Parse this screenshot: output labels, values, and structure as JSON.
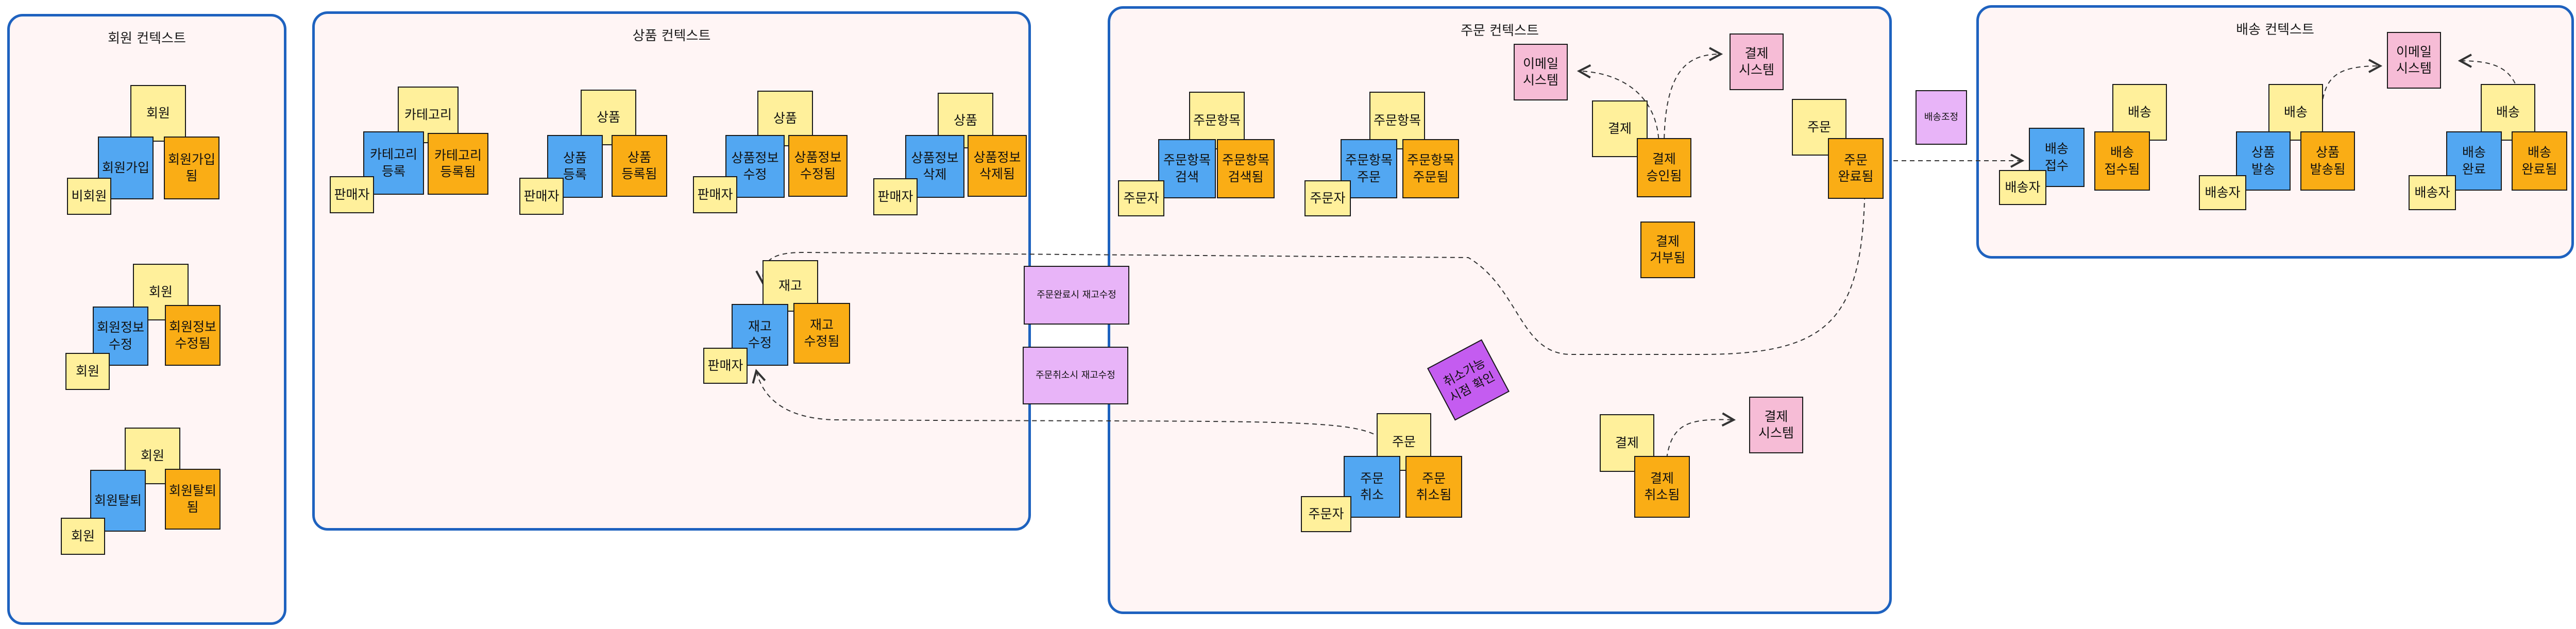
{
  "contexts": {
    "member": "회원 컨텍스트",
    "product": "상품 컨텍스트",
    "order": "주문 컨텍스트",
    "delivery": "배송 컨텍스트"
  },
  "member": {
    "signup": {
      "aggregate": "회원",
      "command": "회원가입",
      "event": "회원가입\n됨",
      "actor": "비회원"
    },
    "update": {
      "aggregate": "회원",
      "command": "회원정보\n수정",
      "event": "회원정보\n수정됨",
      "actor": "회원"
    },
    "withdraw": {
      "aggregate": "회원",
      "command": "회원탈퇴",
      "event": "회원탈퇴\n됨",
      "actor": "회원"
    }
  },
  "product": {
    "category": {
      "aggregate": "카테고리",
      "command": "카테고리\n등록",
      "event": "카테고리\n등록됨",
      "actor": "판매자"
    },
    "register": {
      "aggregate": "상품",
      "command": "상품\n등록",
      "event": "상품\n등록됨",
      "actor": "판매자"
    },
    "modify": {
      "aggregate": "상품",
      "command": "상품정보\n수정",
      "event": "상품정보\n수정됨",
      "actor": "판매자"
    },
    "remove": {
      "aggregate": "상품",
      "command": "상품정보\n삭제",
      "event": "상품정보\n삭제됨",
      "actor": "판매자"
    },
    "stock": {
      "aggregate": "재고",
      "command": "재고\n수정",
      "event": "재고\n수정됨",
      "actor": "판매자"
    }
  },
  "policies": {
    "order_complete_stock": "주문완료시 재고수정",
    "order_cancel_stock": "주문취소시 재고수정",
    "delivery_policy": "배송조정"
  },
  "order": {
    "search": {
      "aggregate": "주문항목",
      "command": "주문항목\n검색",
      "event": "주문항목\n검색됨",
      "actor": "주문자"
    },
    "place": {
      "aggregate": "주문항목",
      "command": "주문항목\n주문",
      "event": "주문항목\n주문됨",
      "actor": "주문자"
    },
    "email_system": "이메일\n시스템",
    "payment_system": "결제\n시스템",
    "payment_aggregate": "결제",
    "payment_approved": "결제\n승인됨",
    "payment_rejected": "결제\n거부됨",
    "order_aggregate": "주문",
    "order_completed": "주문\n완료됨",
    "cancel_check": "취소가능\n시점 확인",
    "cancel": {
      "aggregate": "주문",
      "command": "주문\n취소",
      "event": "주문\n취소됨",
      "actor": "주문자"
    },
    "cancel_payment_aggregate": "결제",
    "payment_cancelled": "결제\n취소됨",
    "cancel_payment_system": "결제\n시스템"
  },
  "delivery": {
    "receive": {
      "aggregate": "배송",
      "command": "배송\n접수",
      "event": "배송\n접수됨",
      "actor": "배송자"
    },
    "ship": {
      "aggregate": "배송",
      "command": "상품\n발송",
      "event": "상품\n발송됨",
      "actor": "배송자"
    },
    "complete": {
      "aggregate": "배송",
      "command": "배송\n완료",
      "event": "배송\n완료됨",
      "actor": "배송자"
    },
    "email_system": "이메일\n시스템"
  }
}
